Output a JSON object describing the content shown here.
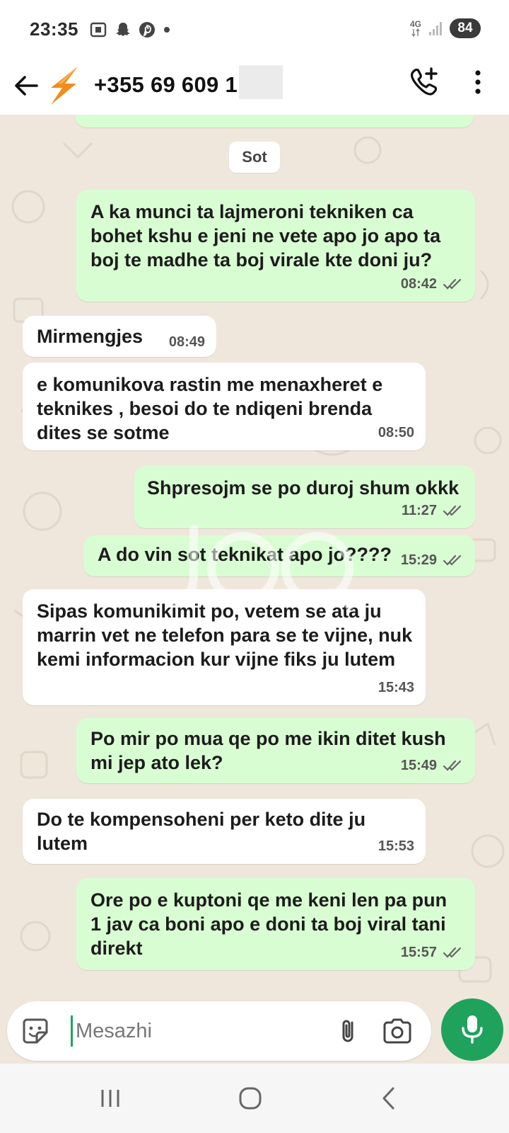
{
  "status_bar": {
    "time": "23:35",
    "network": "4G",
    "battery": "84",
    "icons": [
      "screenshot-icon",
      "snapchat-icon",
      "pinterest-icon",
      "more-dot-icon",
      "signal-icon"
    ]
  },
  "header": {
    "contact": "+355 69 609 1",
    "icons": [
      "back-arrow-icon",
      "lightning-logo-icon",
      "add-call-icon",
      "overflow-menu-icon"
    ]
  },
  "chat": {
    "date_chip": "Sot",
    "messages": [
      {
        "dir": "out",
        "text": "A ka munci ta lajmeroni tekniken ca bohet kshu e jeni ne vete apo jo apo ta boj te madhe ta boj virale kte doni ju?",
        "time": "08:42"
      },
      {
        "dir": "in",
        "text": "Mirmengjes",
        "time": "08:49"
      },
      {
        "dir": "in",
        "text": "e komunikova rastin me menaxheret e teknikes , besoi do te ndiqeni brenda dites se sotme",
        "time": "08:50"
      },
      {
        "dir": "out",
        "text": "Shpresojm se po duroj shum okkk",
        "time": "11:27"
      },
      {
        "dir": "out",
        "text": "A do vin sot teknikat apo jo????",
        "time": "15:29"
      },
      {
        "dir": "in",
        "text": "Sipas komunikimit po, vetem se ata ju marrin vet ne telefon para se te vijne, nuk kemi informacion kur vijne fiks ju lutem",
        "time": "15:43"
      },
      {
        "dir": "out",
        "text": "Po mir po mua qe po me ikin ditet  kush mi jep ato lek?",
        "time": "15:49"
      },
      {
        "dir": "in",
        "text": "Do te kompensoheni per keto dite ju lutem",
        "time": "15:53"
      },
      {
        "dir": "out",
        "text": "Ore po e kuptoni qe me keni len pa pun 1 jav ca boni apo e doni ta boj viral tani direkt",
        "time": "15:57"
      }
    ]
  },
  "composer": {
    "placeholder": "Mesazhi",
    "icons": [
      "sticker-icon",
      "attach-icon",
      "camera-icon",
      "mic-icon"
    ]
  },
  "nav": {
    "icons": [
      "recents-icon",
      "home-icon",
      "back-icon"
    ]
  },
  "colors": {
    "outgoing_bubble": "#d9fdd3",
    "incoming_bubble": "#ffffff",
    "chat_background": "#efe7dc",
    "accent_green": "#1ea25c",
    "read_ticks": "#6b6b6b"
  }
}
